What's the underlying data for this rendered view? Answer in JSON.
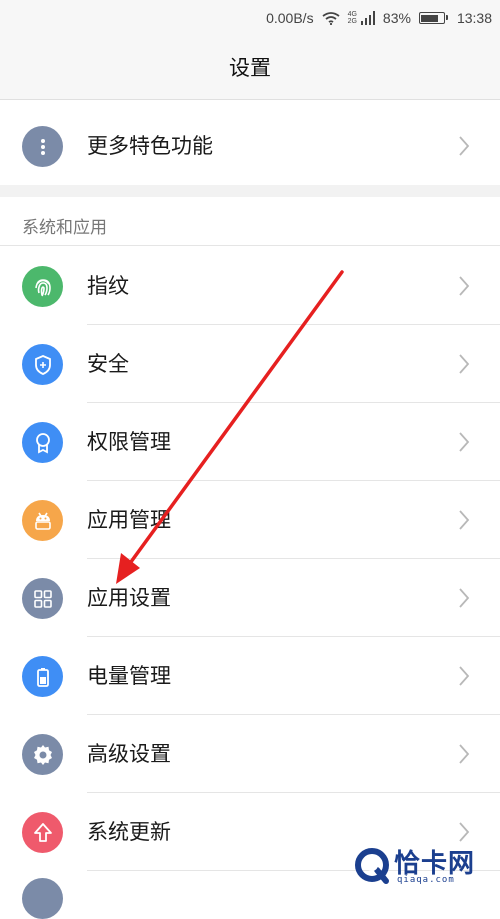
{
  "status_bar": {
    "speed": "0.00B/s",
    "net_top": "4G",
    "net_bottom": "2G",
    "battery_percent": "83%",
    "battery_level": 0.83,
    "time": "13:38",
    "icons": [
      "wifi-icon",
      "signal-icon",
      "battery-icon"
    ]
  },
  "title": "设置",
  "more_features": {
    "label": "更多特色功能",
    "icon": "more-dots-icon",
    "color": "#7b8ba8"
  },
  "section": {
    "header": "系统和应用",
    "items": [
      {
        "label": "指纹",
        "icon": "fingerprint-icon",
        "color": "#4cb86c"
      },
      {
        "label": "安全",
        "icon": "shield-icon",
        "color": "#3f8ef5"
      },
      {
        "label": "权限管理",
        "icon": "badge-icon",
        "color": "#3f8ef5"
      },
      {
        "label": "应用管理",
        "icon": "android-icon",
        "color": "#f6a64a"
      },
      {
        "label": "应用设置",
        "icon": "grid-icon",
        "color": "#7b8ba8"
      },
      {
        "label": "电量管理",
        "icon": "battery-icon",
        "color": "#3f8ef5"
      },
      {
        "label": "高级设置",
        "icon": "gear-icon",
        "color": "#7b8ba8"
      },
      {
        "label": "系统更新",
        "icon": "upgrade-arrow-icon",
        "color": "#ef5a6c"
      }
    ]
  },
  "annotation": {
    "arrow_color": "#e62020"
  },
  "watermark": {
    "name": "恰卡网",
    "url": "qiaqa.com",
    "color": "#1b3f8f"
  }
}
